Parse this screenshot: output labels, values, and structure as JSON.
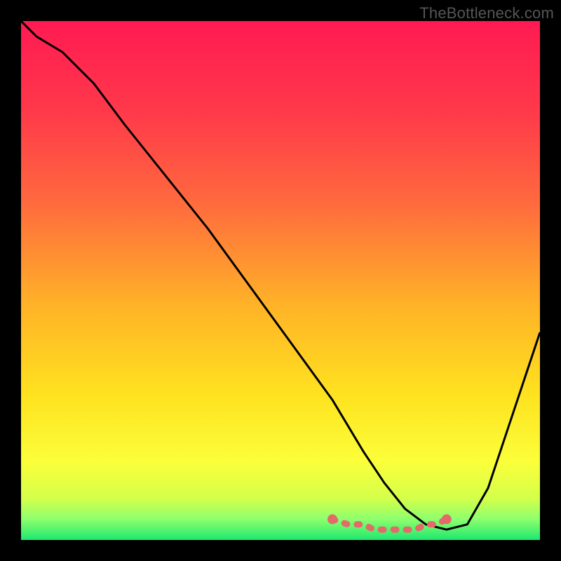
{
  "watermark": "TheBottleneck.com",
  "chart_data": {
    "type": "line",
    "title": "",
    "xlabel": "",
    "ylabel": "",
    "xlim": [
      0,
      100
    ],
    "ylim": [
      0,
      100
    ],
    "series": [
      {
        "name": "curve",
        "x": [
          0,
          3,
          8,
          14,
          20,
          28,
          36,
          44,
          52,
          60,
          66,
          70,
          74,
          78,
          82,
          86,
          90,
          94,
          98,
          100
        ],
        "y": [
          100,
          97,
          94,
          88,
          80,
          70,
          60,
          49,
          38,
          27,
          17,
          11,
          6,
          3,
          2,
          3,
          10,
          22,
          34,
          40
        ]
      }
    ],
    "flat_region": {
      "x": [
        60,
        63,
        66,
        68,
        70,
        72,
        74,
        76,
        78,
        80,
        82
      ],
      "y": [
        4,
        3,
        3,
        2,
        2,
        2,
        2,
        2,
        3,
        3,
        4
      ]
    },
    "gradient_stops": [
      {
        "offset": 0.0,
        "color": "#ff1a52"
      },
      {
        "offset": 0.18,
        "color": "#ff3a4a"
      },
      {
        "offset": 0.35,
        "color": "#ff6a3e"
      },
      {
        "offset": 0.55,
        "color": "#ffb327"
      },
      {
        "offset": 0.72,
        "color": "#ffe21f"
      },
      {
        "offset": 0.85,
        "color": "#fbff3a"
      },
      {
        "offset": 0.92,
        "color": "#d4ff4a"
      },
      {
        "offset": 0.96,
        "color": "#8dff6e"
      },
      {
        "offset": 1.0,
        "color": "#1ee86f"
      }
    ],
    "curve_color": "#000000",
    "marker_color": "#e46a6a"
  }
}
